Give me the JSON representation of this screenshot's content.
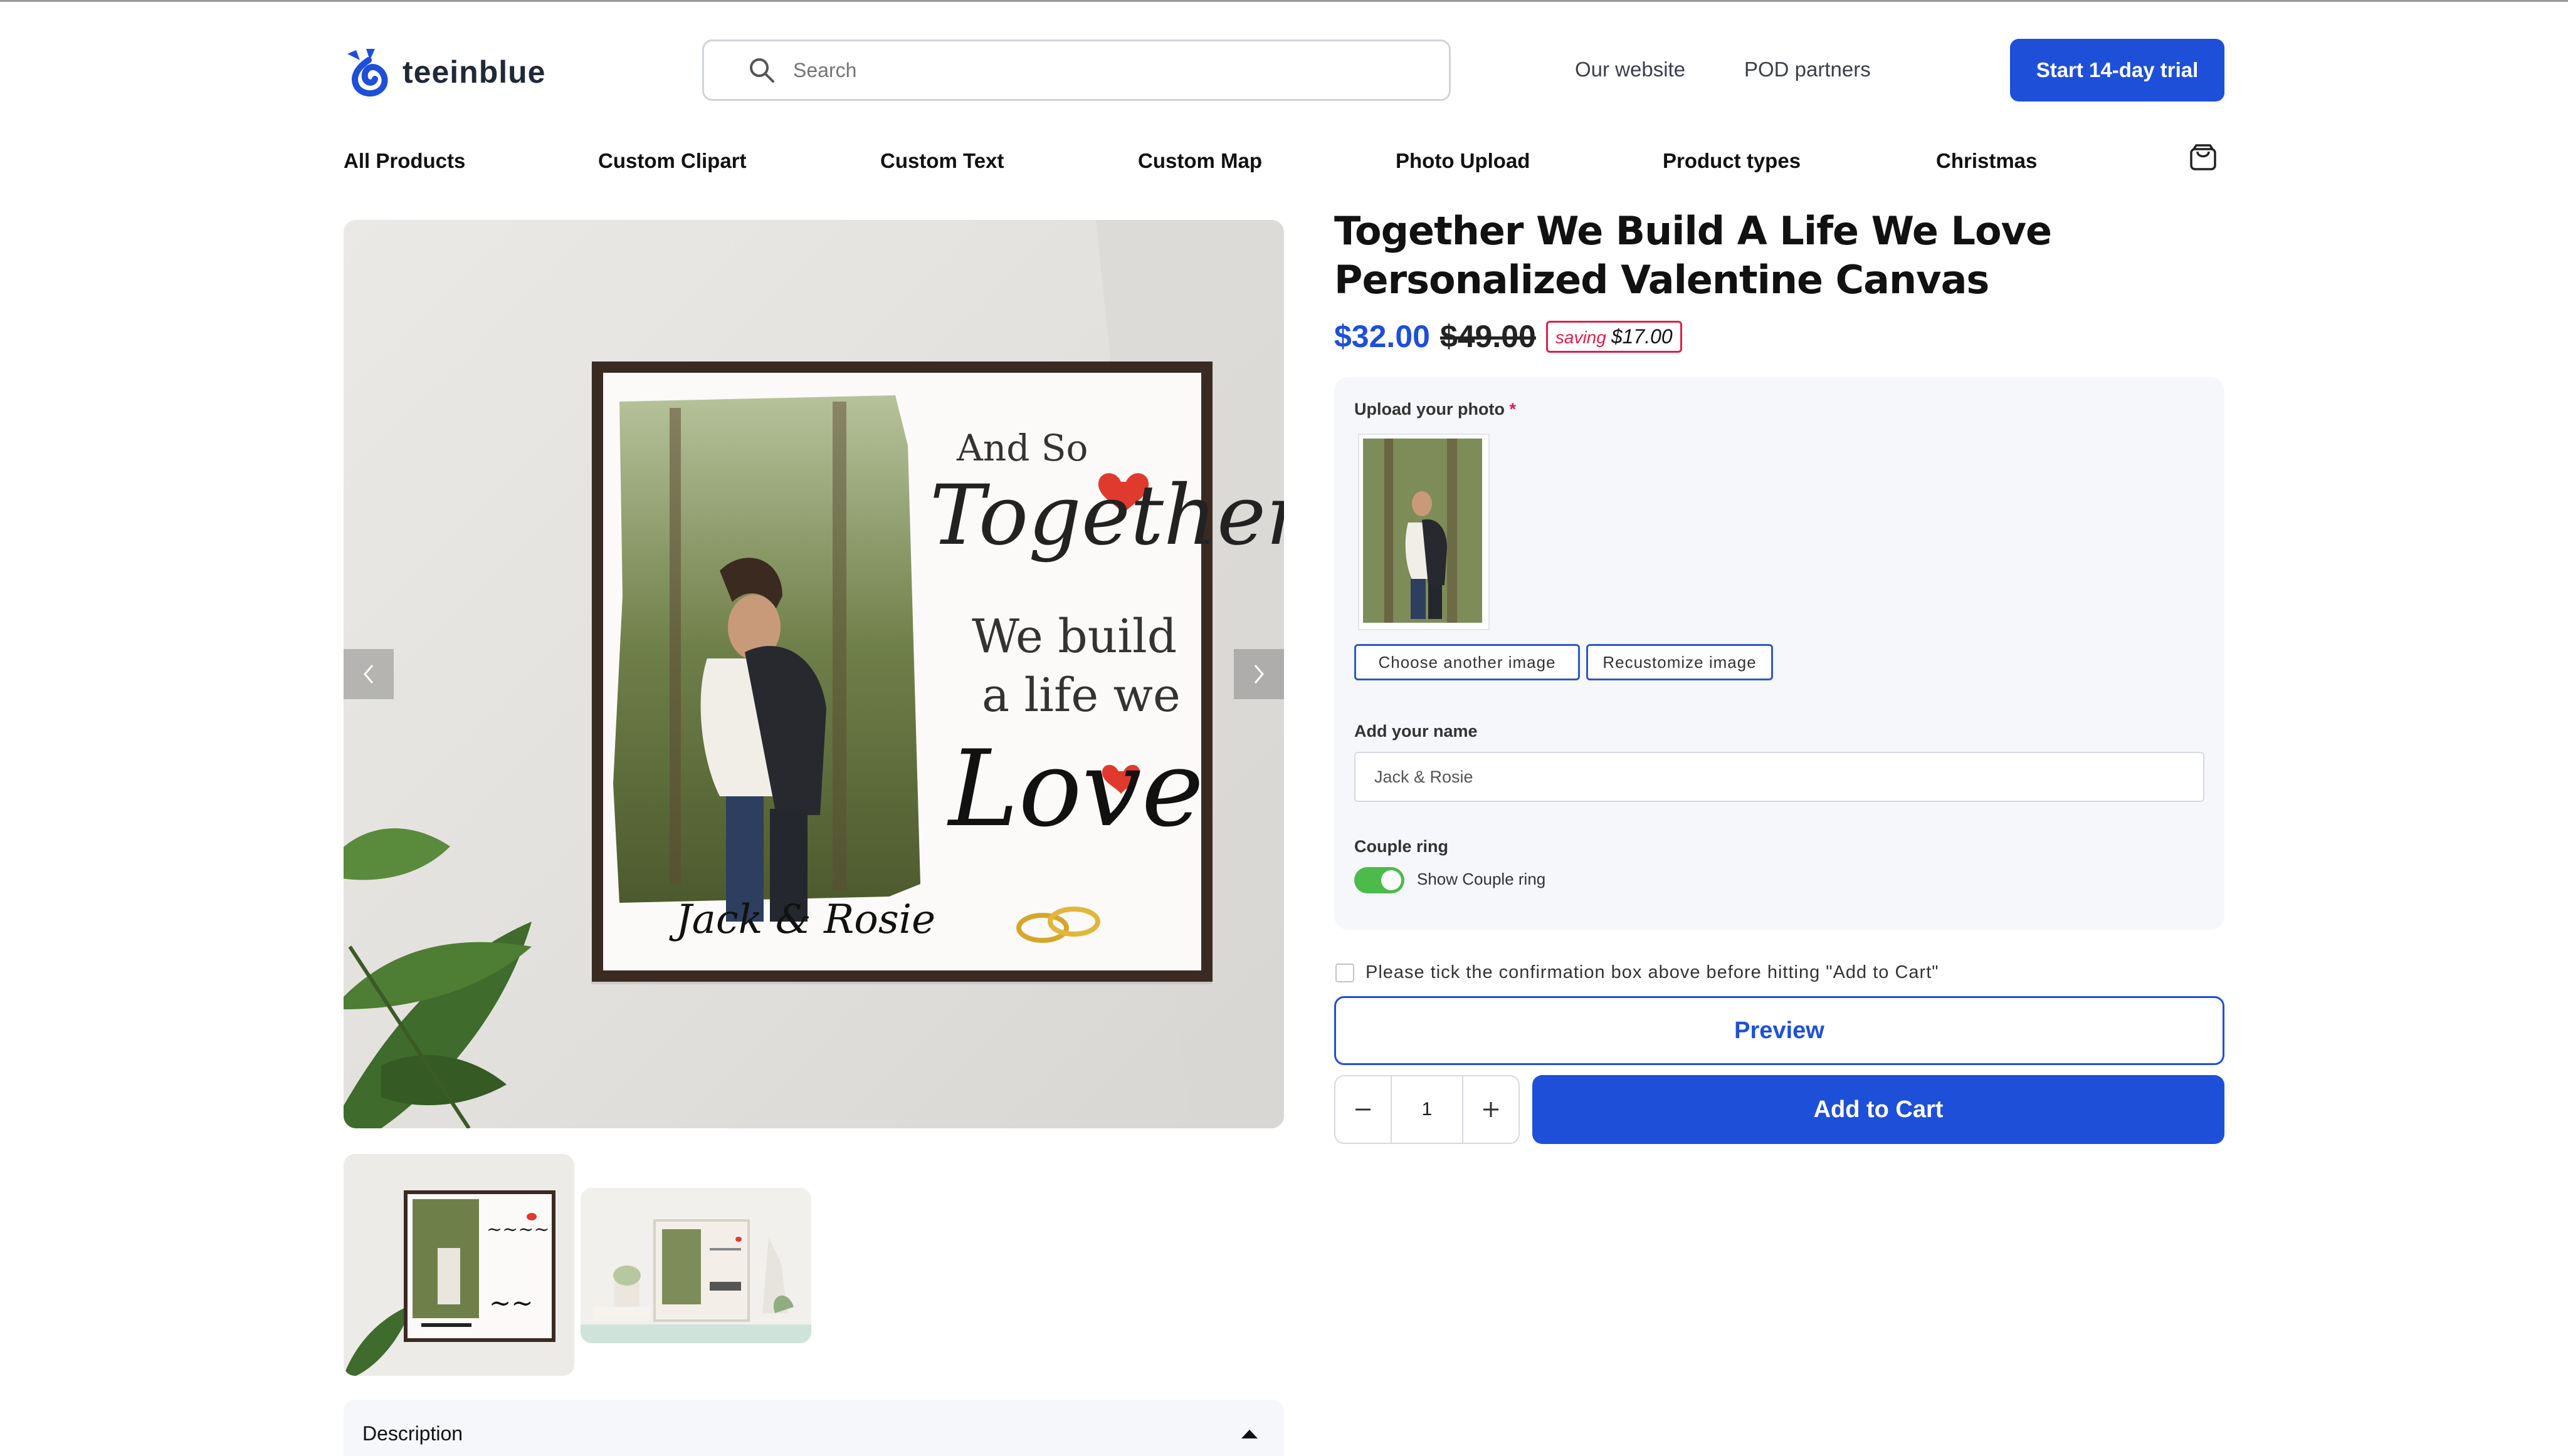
{
  "brand": {
    "name": "teeinblue",
    "accent": "#1e4fd8"
  },
  "search": {
    "placeholder": "Search"
  },
  "header": {
    "links": [
      "Our website",
      "POD partners"
    ],
    "trial_label": "Start 14-day trial"
  },
  "nav": {
    "items": [
      "All Products",
      "Custom Clipart",
      "Custom Text",
      "Custom Map",
      "Photo Upload",
      "Product types",
      "Christmas"
    ]
  },
  "artwork": {
    "line1": "And So",
    "line2": "Together",
    "line3": "We build",
    "line4": "a life we",
    "line5": "Love",
    "names": "Jack & Rosie"
  },
  "product": {
    "title": "Together We Build A Life We Love Personalized Valentine Canvas",
    "price": "$32.00",
    "compare_price": "$49.00",
    "saving_label": "saving",
    "saving_amount": "$17.00"
  },
  "customize": {
    "upload_label": "Upload your photo",
    "required_mark": "*",
    "choose_label": "Choose another image",
    "recustomize_label": "Recustomize image",
    "name_label": "Add your name",
    "name_value": "Jack & Rosie",
    "ring_label": "Couple ring",
    "ring_toggle_label": "Show Couple ring",
    "ring_enabled": true
  },
  "confirm_text": "Please tick the confirmation box above before hitting \"Add to Cart\"",
  "actions": {
    "preview_label": "Preview",
    "quantity": "1",
    "add_label": "Add to Cart"
  },
  "description_label": "Description",
  "icons": [
    "logo-icon",
    "search-icon",
    "cart-icon",
    "chevron-left-icon",
    "chevron-right-icon",
    "minus-icon",
    "plus-icon",
    "caret-up-icon"
  ]
}
